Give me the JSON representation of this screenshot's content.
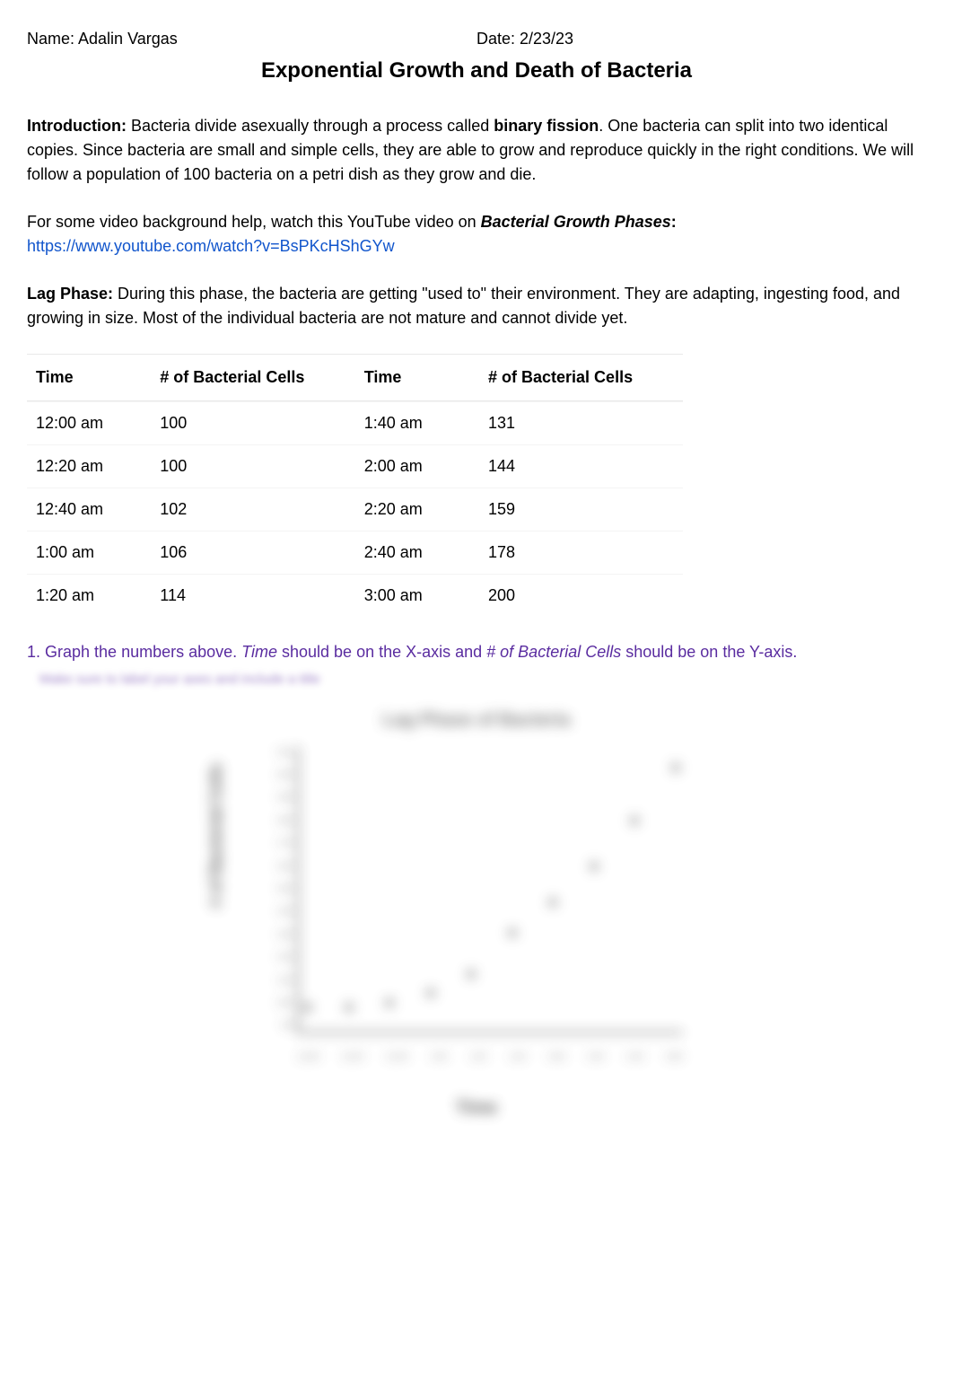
{
  "header": {
    "name_label": "Name:",
    "name_value": "Adalin Vargas",
    "date_label": "Date:",
    "date_value": "2/23/23"
  },
  "title": "Exponential Growth and Death of Bacteria",
  "intro": {
    "label": "Introduction:",
    "text_part1": " Bacteria divide asexually through a process called ",
    "term1": "binary fission",
    "text_part2": ". One bacteria can split into two identical copies. Since bacteria are small and simple cells, they are able to grow and reproduce quickly in the right conditions. We will follow a population of 100 bacteria on a petri dish as they grow and die."
  },
  "video": {
    "lead": "For some video background help, watch this YouTube video on ",
    "title": "Bacterial Growth Phases",
    "colon": ":",
    "url": "https://www.youtube.com/watch?v=BsPKcHShGYw"
  },
  "lag": {
    "label": "Lag Phase:",
    "text": " During this phase, the bacteria are getting \"used to\" their environment. They are adapting, ingesting food, and growing in size. Most of the individual bacteria are not mature and cannot divide yet."
  },
  "table": {
    "time_header": "Time",
    "count_header": "# of Bacterial Cells",
    "left": [
      {
        "time": "12:00 am",
        "count": "100"
      },
      {
        "time": "12:20 am",
        "count": "100"
      },
      {
        "time": "12:40 am",
        "count": "102"
      },
      {
        "time": "1:00 am",
        "count": "106"
      },
      {
        "time": "1:20 am",
        "count": "114"
      }
    ],
    "right": [
      {
        "time": "1:40 am",
        "count": "131"
      },
      {
        "time": "2:00 am",
        "count": "144"
      },
      {
        "time": "2:20 am",
        "count": "159"
      },
      {
        "time": "2:40 am",
        "count": "178"
      },
      {
        "time": "3:00 am",
        "count": "200"
      }
    ]
  },
  "instruction": {
    "num": "1. ",
    "text1": "Graph the numbers above. ",
    "time_word": "Time",
    "text2": " should be on the X-axis and ",
    "cells_word": "# of Bacterial Cells",
    "text3": " should be on the Y-axis."
  },
  "blurred_hint": "Make sure to label your axes and include a title",
  "chart_data": {
    "type": "scatter",
    "title": "Lag Phase of Bacteria",
    "xlabel": "Time",
    "ylabel": "# of Bacterial Cells",
    "categories": [
      "12:00",
      "12:20",
      "12:40",
      "1:00",
      "1:20",
      "1:40",
      "2:00",
      "2:20",
      "2:40",
      "3:00"
    ],
    "values": [
      100,
      100,
      102,
      106,
      114,
      131,
      144,
      159,
      178,
      200
    ],
    "ylim": [
      90,
      210
    ],
    "yticks": [
      90,
      100,
      110,
      120,
      130,
      140,
      150,
      160,
      170,
      180,
      190,
      200,
      210
    ]
  }
}
